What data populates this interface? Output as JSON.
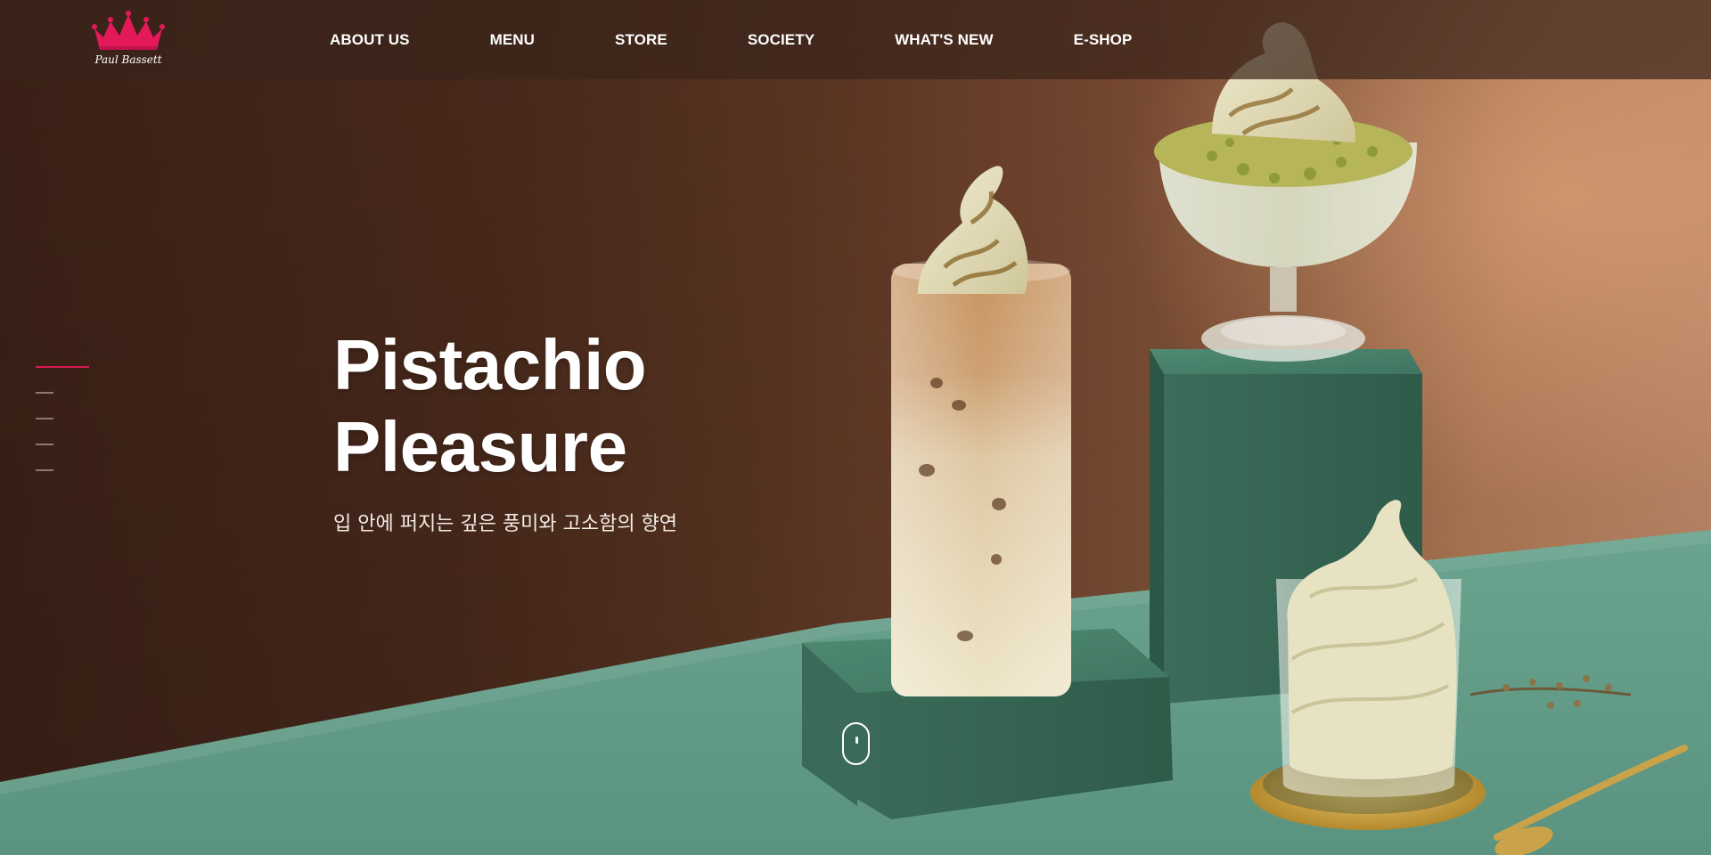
{
  "brand": {
    "logo_text": "Paul Bassett",
    "accent_color": "#d81b55"
  },
  "nav": {
    "items": [
      {
        "label": "ABOUT US"
      },
      {
        "label": "MENU"
      },
      {
        "label": "STORE"
      },
      {
        "label": "SOCIETY"
      },
      {
        "label": "WHAT'S NEW"
      },
      {
        "label": "E-SHOP"
      }
    ]
  },
  "hero": {
    "title_line1": "Pistachio",
    "title_line2": "Pleasure",
    "subtitle": "입 안에 퍼지는 깊은 풍미와 고소함의 향연"
  },
  "pager": {
    "slide_count": 5,
    "active_index": 0
  },
  "icons": {
    "logo": "crown-logo-icon",
    "scroll": "scroll-mouse-icon"
  }
}
